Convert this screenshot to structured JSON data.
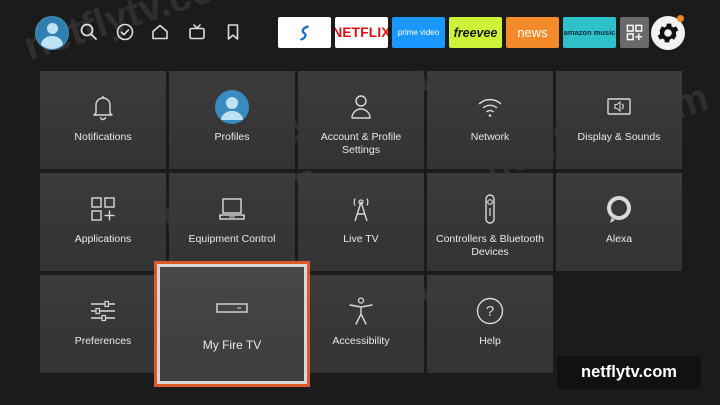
{
  "watermark": "netflytv.com",
  "top_bar": {
    "nav_icons": [
      {
        "icon": "search-icon"
      },
      {
        "icon": "check-circle-icon"
      },
      {
        "icon": "home-icon"
      },
      {
        "icon": "live-tv-icon"
      },
      {
        "icon": "bookmark-icon"
      }
    ],
    "apps": [
      {
        "name": "app-tile-unknown",
        "label": "",
        "bg": "#ffffff",
        "fg": "#1a73c9"
      },
      {
        "name": "app-tile-netflix",
        "label": "NETFLIX",
        "bg": "#ffffff",
        "fg": "#e50914"
      },
      {
        "name": "app-tile-prime-video",
        "label": "prime video",
        "bg": "#1a98ff",
        "fg": "#ffffff"
      },
      {
        "name": "app-tile-freevee",
        "label": "freevee",
        "bg": "#cef23a",
        "fg": "#1a1a1a"
      },
      {
        "name": "app-tile-news",
        "label": "news",
        "bg": "#f58a2a",
        "fg": "#ffffff"
      },
      {
        "name": "app-tile-amazon-music",
        "label": "amazon music",
        "bg": "#2fc1c9",
        "fg": "#0d2b3a"
      }
    ],
    "settings_selected": true
  },
  "settings": {
    "tiles": [
      {
        "id": "notifications",
        "label": "Notifications",
        "icon": "bell-icon"
      },
      {
        "id": "profiles",
        "label": "Profiles",
        "icon": "profile-avatar-icon"
      },
      {
        "id": "account-profile-settings",
        "label": "Account & Profile Settings",
        "icon": "person-icon"
      },
      {
        "id": "network",
        "label": "Network",
        "icon": "wifi-icon"
      },
      {
        "id": "display-sounds",
        "label": "Display & Sounds",
        "icon": "display-sound-icon"
      },
      {
        "id": "applications",
        "label": "Applications",
        "icon": "apps-grid-icon"
      },
      {
        "id": "equipment-control",
        "label": "Equipment Control",
        "icon": "monitor-icon"
      },
      {
        "id": "live-tv",
        "label": "Live TV",
        "icon": "antenna-icon"
      },
      {
        "id": "controllers-bluetooth",
        "label": "Controllers & Bluetooth Devices",
        "icon": "remote-icon"
      },
      {
        "id": "alexa",
        "label": "Alexa",
        "icon": "alexa-icon"
      },
      {
        "id": "preferences",
        "label": "Preferences",
        "icon": "sliders-icon"
      },
      {
        "id": "my-fire-tv",
        "label": "My Fire TV",
        "icon": "fire-tv-device-icon"
      },
      {
        "id": "accessibility",
        "label": "Accessibility",
        "icon": "accessibility-icon"
      },
      {
        "id": "help",
        "label": "Help",
        "icon": "help-icon"
      }
    ],
    "focused": "my-fire-tv"
  },
  "colors": {
    "accent_focus_border": "#e0572a",
    "focus_inner_border": "#d8d8d8"
  }
}
